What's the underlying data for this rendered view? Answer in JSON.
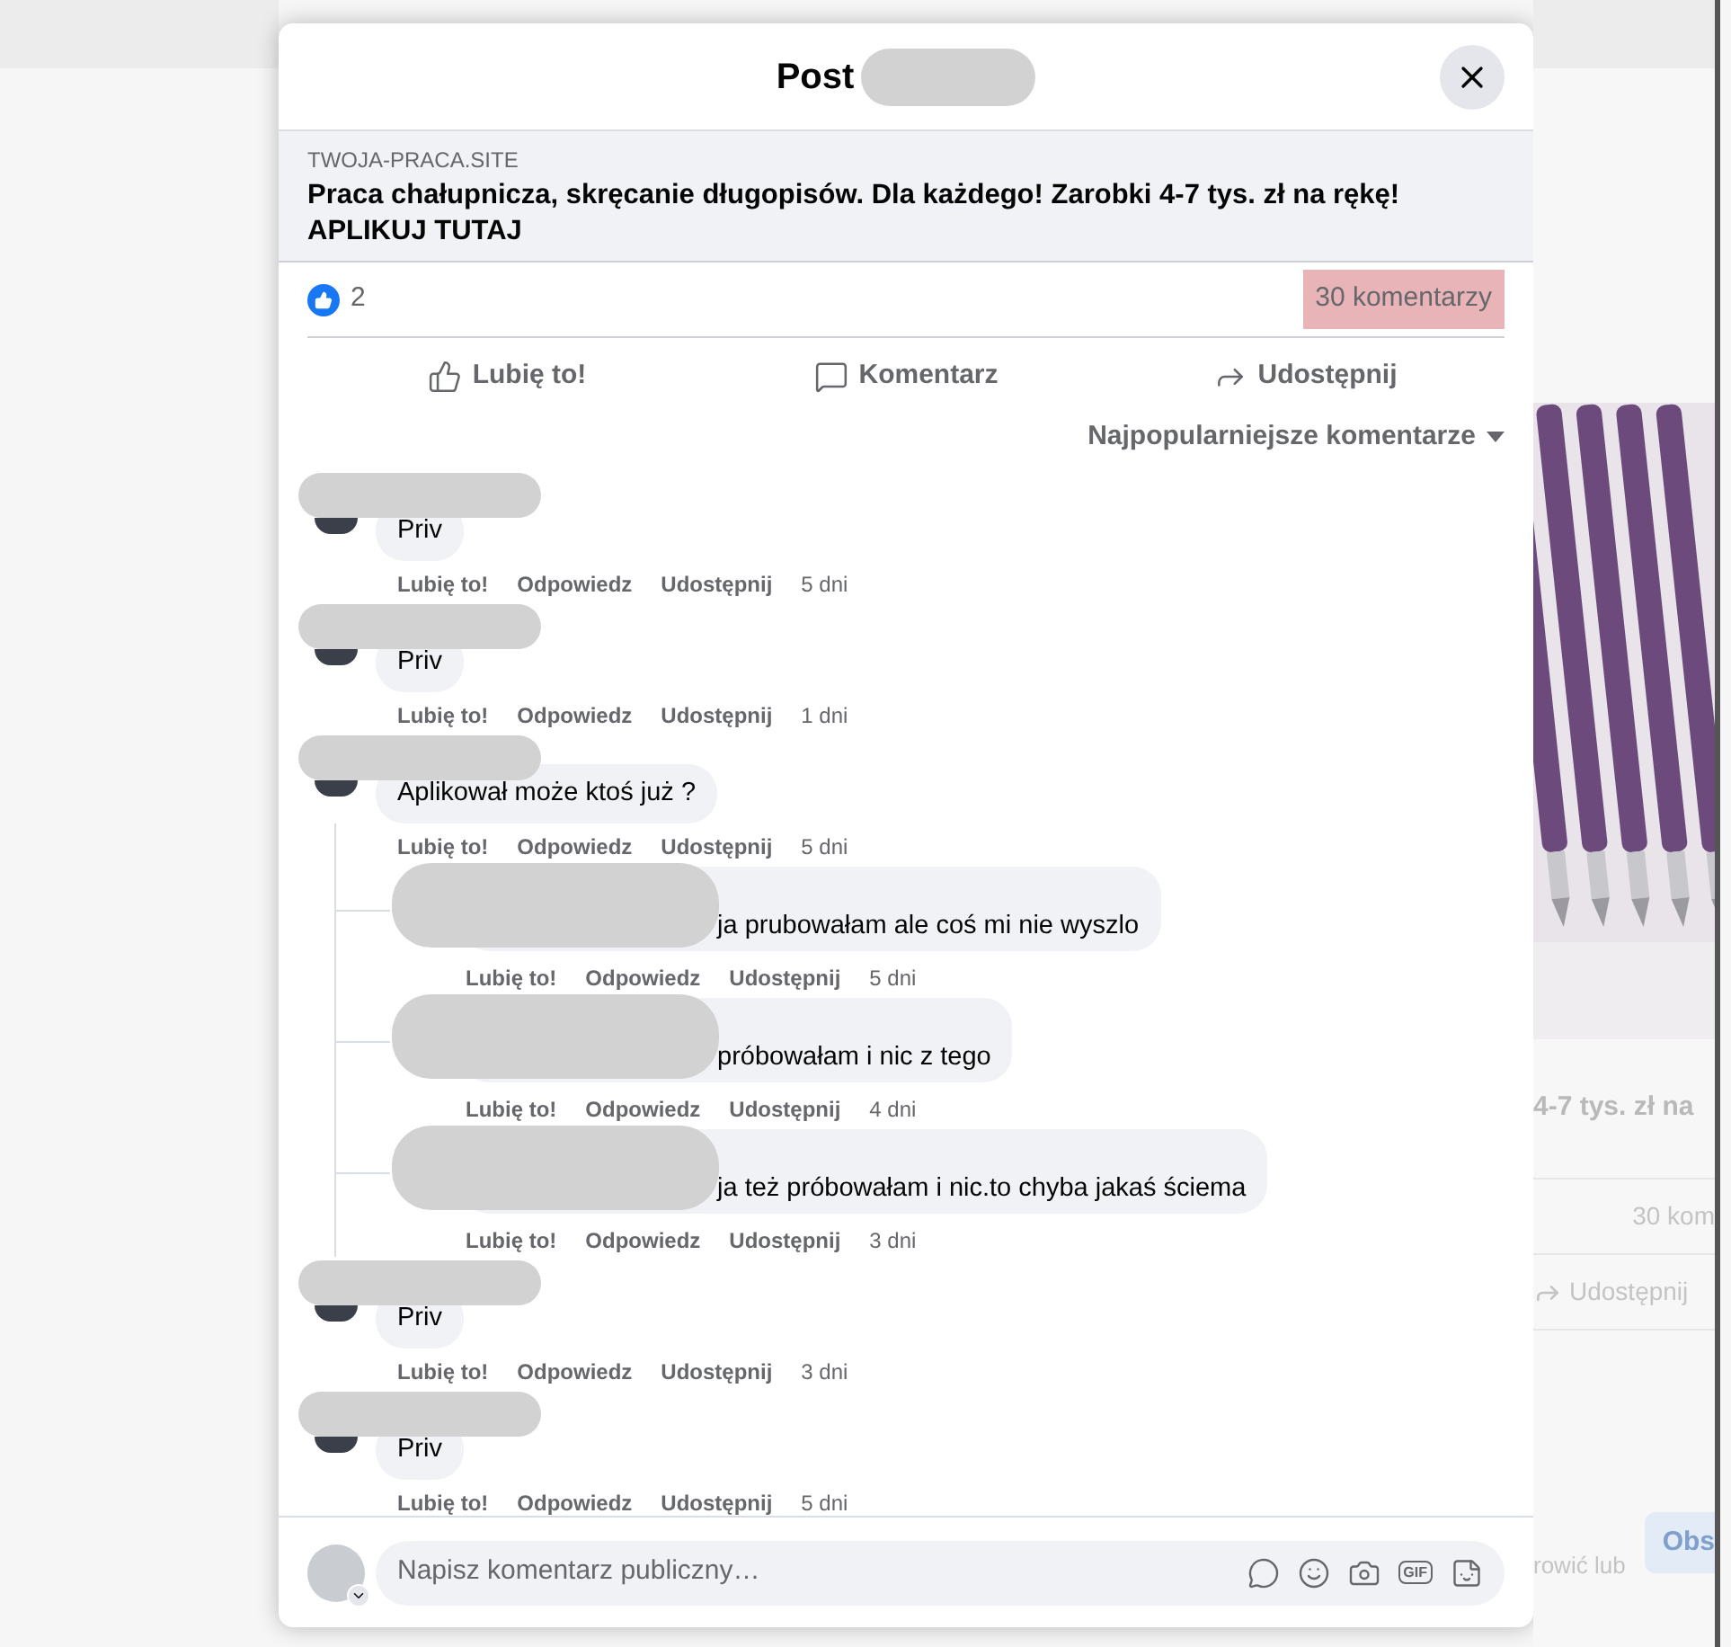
{
  "modal": {
    "title": "Post"
  },
  "link_preview": {
    "domain": "TWOJA-PRACA.SITE",
    "title": "Praca chałupnicza, skręcanie długopisów. Dla każdego! Zarobki 4-7 tys. zł na rękę! APLIKUJ TUTAJ"
  },
  "reactions": {
    "count": "2"
  },
  "comments_count": {
    "label": "30 komentarzy",
    "highlighted": true
  },
  "actions": [
    {
      "kind": "like",
      "label": "Lubię to!"
    },
    {
      "kind": "comment",
      "label": "Komentarz"
    },
    {
      "kind": "share",
      "label": "Udostępnij"
    }
  ],
  "sort": {
    "label": "Najpopularniejsze komentarze"
  },
  "comments": [
    {
      "text": "Priv",
      "actions": [
        "Lubię to!",
        "Odpowiedz",
        "Udostępnij"
      ],
      "time": "5 dni"
    },
    {
      "text": "Priv",
      "actions": [
        "Lubię to!",
        "Odpowiedz",
        "Udostępnij"
      ],
      "time": "1 dni"
    },
    {
      "text": "Aplikował może ktoś już ?",
      "actions": [
        "Lubię to!",
        "Odpowiedz",
        "Udostępnij"
      ],
      "time": "5 dni",
      "children": [
        {
          "text": "ja prubowałam ale coś mi nie wyszlo",
          "actions": [
            "Lubię to!",
            "Odpowiedz",
            "Udostępnij"
          ],
          "time": "5 dni"
        },
        {
          "text": "próbowałam i nic z tego",
          "actions": [
            "Lubię to!",
            "Odpowiedz",
            "Udostępnij"
          ],
          "time": "4 dni"
        },
        {
          "text": "ja też próbowałam i nic.to chyba jakaś ściema",
          "actions": [
            "Lubię to!",
            "Odpowiedz",
            "Udostępnij"
          ],
          "time": "3 dni"
        }
      ]
    },
    {
      "text": "Priv",
      "actions": [
        "Lubię to!",
        "Odpowiedz",
        "Udostępnij"
      ],
      "time": "3 dni"
    },
    {
      "text": "Priv",
      "actions": [
        "Lubię to!",
        "Odpowiedz",
        "Udostępnij"
      ],
      "time": "5 dni"
    }
  ],
  "composer": {
    "placeholder": "Napisz komentarz publiczny…",
    "gif_label": "GIF"
  },
  "background": {
    "headline": "4-7 tys. zł na",
    "comments": "30 kom",
    "share": "Udostępnij",
    "footer": "rowić lub",
    "button": "Obs"
  }
}
